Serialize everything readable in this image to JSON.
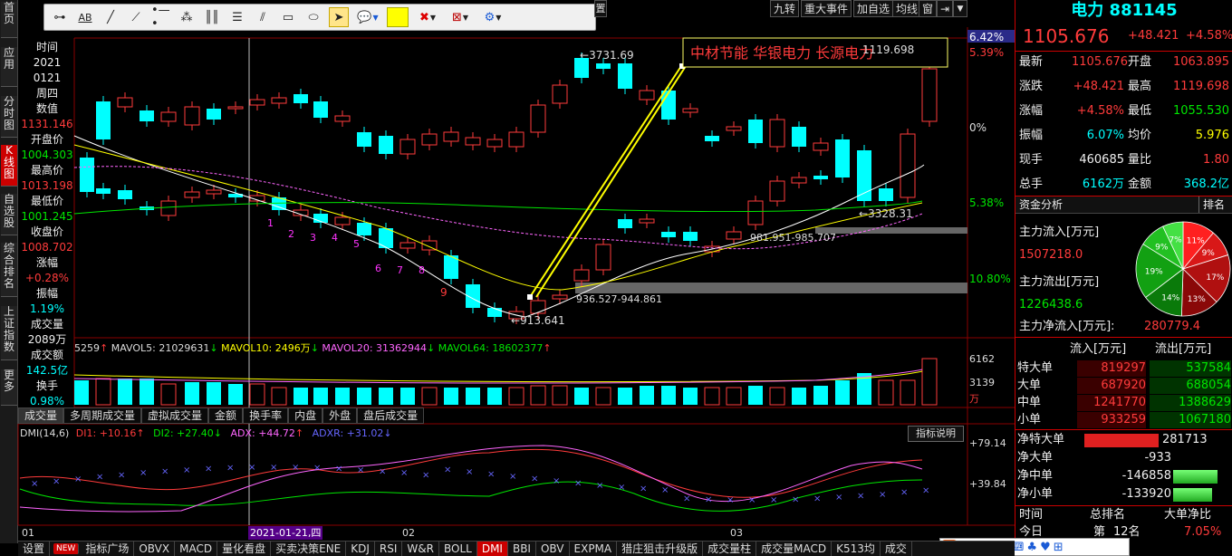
{
  "left_nav": [
    "首页",
    "应用",
    "分时图",
    "K线图",
    "自选股",
    "综合排名",
    "上证指数",
    "更多"
  ],
  "left_nav_active": 3,
  "toolbar_icons": [
    "horizontal-line-icon",
    "text-label-icon",
    "line-segment-icon",
    "polyline-icon",
    "point-line-icon",
    "sparkle-icon",
    "vertical-bars-icon",
    "fibonacci-icon",
    "parallel-lines-icon",
    "rectangle-icon",
    "ellipse-icon",
    "cursor-icon",
    "comment-icon",
    "color-swatch-icon",
    "delete-icon",
    "erase-icon",
    "settings-icon"
  ],
  "top_buttons": [
    "九转",
    "重大事件",
    "加自选",
    "均线",
    "窗"
  ],
  "info_col": {
    "time_label": "时间",
    "year": "2021",
    "date": "0121",
    "weekday": "周四",
    "value_label": "数值",
    "value": "1131.146",
    "open_label": "开盘价",
    "open": "1004.303",
    "high_label": "最高价",
    "high": "1013.198",
    "low_label": "最低价",
    "low": "1001.245",
    "close_label": "收盘价",
    "close": "1008.702",
    "chg_label": "涨幅",
    "chg": "+0.28%",
    "amp_label": "振幅",
    "amp": "1.19%",
    "vol_label": "成交量",
    "vol": "2089万",
    "amt_label": "成交额",
    "amt": "142.5亿",
    "turn_label": "换手",
    "turn": "0.98%"
  },
  "chart_labels": {
    "high_price": "3731.69",
    "low_price": "913.641",
    "low2": "3328.31",
    "peak_label": "1119.698",
    "zone1": "981.951-985.707",
    "zone2": "936.527-944.861",
    "news": "中材节能   华银电力   长源电力",
    "seq": [
      "1",
      "2",
      "3",
      "4",
      "5",
      "6",
      "7",
      "8",
      "9"
    ],
    "pct_top": "6.42%",
    "pct_1": "5.39%",
    "pct_2": "0%",
    "pct_3": "5.38%",
    "pct_4": "10.80%"
  },
  "volume": {
    "ma_text": "MAVOL5: 21029631",
    "ma10": "MAVOL10: 2496万",
    "ma20": "MAVOL20: 31362944",
    "ma64": "MAVOL64: 18602377",
    "first": "5259",
    "axis_top": "6162",
    "axis_mid": "3139",
    "axis_unit": "万",
    "tabs": [
      "成交量",
      "多周期成交量",
      "虚拟成交量",
      "金额",
      "换手率",
      "内盘",
      "外盘",
      "盘后成交量"
    ]
  },
  "dmi": {
    "title": "DMI(14,6)",
    "di1": "DI1: +10.16",
    "di2": "DI2: +27.40",
    "adx": "ADX: +44.72",
    "adxr": "ADXR: +31.02",
    "axis_top": "+79.14",
    "axis_mid": "+39.84",
    "explain": "指标说明"
  },
  "time_axis": [
    "01",
    "2021-01-21,四",
    "02",
    "03"
  ],
  "bottom_tabs": [
    "设置",
    "NEW",
    "指标广场",
    "OBVX",
    "MACD",
    "量化看盘",
    "买卖决策ENE",
    "KDJ",
    "RSI",
    "W&R",
    "BOLL",
    "DMI",
    "BBI",
    "OBV",
    "EXPMA",
    "猎庄狙击升级版",
    "成交量柱",
    "成交量MACD",
    "K513均",
    "成交"
  ],
  "bottom_active": "DMI",
  "panel": {
    "title": "电力 881145",
    "price": "1105.676",
    "change": "+48.421",
    "change_pct": "+4.58%",
    "rows": [
      {
        "l1": "最新",
        "v1": "1105.676",
        "l2": "开盘",
        "v2": "1063.895",
        "c1": "red",
        "c2": "red"
      },
      {
        "l1": "涨跌",
        "v1": "+48.421",
        "l2": "最高",
        "v2": "1119.698",
        "c1": "red",
        "c2": "red"
      },
      {
        "l1": "涨幅",
        "v1": "+4.58%",
        "l2": "最低",
        "v2": "1055.530",
        "c1": "red",
        "c2": "green"
      },
      {
        "l1": "振幅",
        "v1": "6.07%",
        "l2": "均价",
        "v2": "5.976",
        "c1": "cyan",
        "c2": "yellow"
      },
      {
        "l1": "现手",
        "v1": "460685",
        "l2": "量比",
        "v2": "1.80",
        "c1": "white",
        "c2": "red"
      },
      {
        "l1": "总手",
        "v1": "6162万",
        "l2": "金额",
        "v2": "368.2亿",
        "c1": "cyan",
        "c2": "cyan"
      }
    ],
    "fund_tab": "资金分析",
    "rank_tab": "排名",
    "inflow_label": "主力流入[万元]",
    "inflow": "1507218.0",
    "outflow_label": "主力流出[万元]",
    "outflow": "1226438.6",
    "net_label": "主力净流入[万元]:",
    "net": "280779.4",
    "pie": [
      11,
      9,
      17,
      13,
      14,
      19,
      9,
      7
    ],
    "pie_labels": [
      "11%",
      "9%",
      "17%",
      "13%",
      "14%",
      "19%",
      "9%",
      "7%"
    ],
    "flow_header_in": "流入[万元]",
    "flow_header_out": "流出[万元]",
    "flows": [
      {
        "label": "特大单",
        "in": "819297",
        "out": "537584"
      },
      {
        "label": "大单",
        "in": "687920",
        "out": "688054"
      },
      {
        "label": "中单",
        "in": "1241770",
        "out": "1388629"
      },
      {
        "label": "小单",
        "in": "933259",
        "out": "1067180"
      }
    ],
    "nets": [
      {
        "label": "净特大单",
        "value": "281713"
      },
      {
        "label": "净大单",
        "value": "-933"
      },
      {
        "label": "净中单",
        "value": "-146858"
      },
      {
        "label": "净小单",
        "value": "-133920"
      }
    ],
    "rank_header": [
      "时间",
      "总排名",
      "大单净比"
    ],
    "rank_row": [
      "今日",
      "第",
      "12名",
      "7.05%"
    ],
    "ime": [
      "中",
      "♪",
      "☾",
      "•",
      "⌨",
      "♣",
      "♥",
      "⊞"
    ]
  }
}
